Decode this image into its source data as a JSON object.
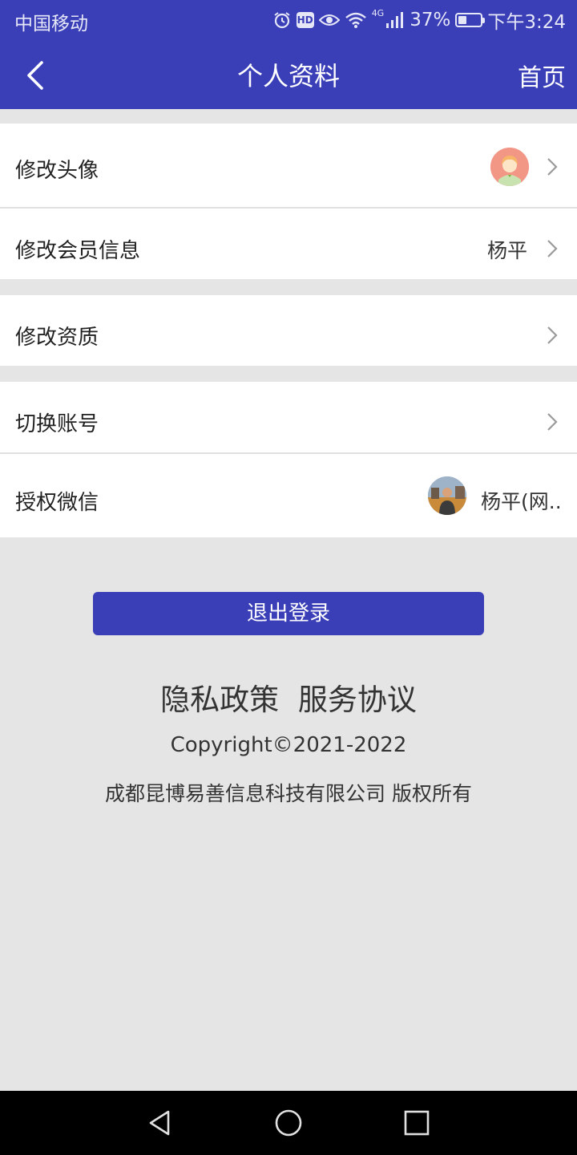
{
  "status_bar": {
    "carrier": "中国移动",
    "network": "4G",
    "battery": "37%",
    "battery_level": 0.37,
    "time": "下午3:24",
    "icons": [
      "alarm-icon",
      "hd-icon",
      "eye-icon",
      "wifi-icon",
      "signal-icon",
      "battery-icon"
    ]
  },
  "nav": {
    "back_icon": "chevron-left-icon",
    "title": "个人资料",
    "home_label": "首页"
  },
  "menu": {
    "avatar": {
      "label": "修改头像"
    },
    "member": {
      "label": "修改会员信息",
      "value": "杨平"
    },
    "qualification": {
      "label": "修改资质"
    },
    "switch_account": {
      "label": "切换账号"
    },
    "wechat": {
      "label": "授权微信",
      "value": "杨平(网.."
    }
  },
  "logout_label": "退出登录",
  "footer": {
    "privacy": "隐私政策",
    "terms": "服务协议",
    "copyright": "Copyright©2021-2022",
    "company": "成都昆博易善信息科技有限公司 版权所有"
  },
  "colors": {
    "brand": "#3a3fb8",
    "background": "#e5e5e5"
  },
  "system_nav": [
    "back-triangle-icon",
    "home-circle-icon",
    "recents-square-icon"
  ]
}
